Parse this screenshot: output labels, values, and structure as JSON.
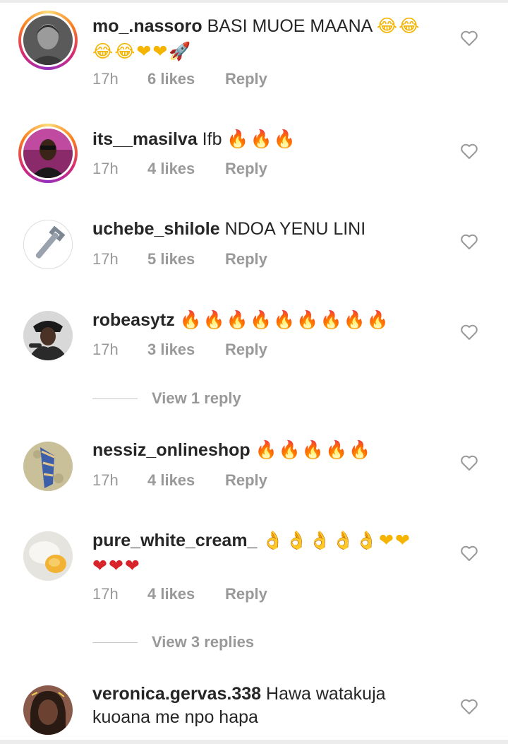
{
  "comments": [
    {
      "username": "mo_.nassoro",
      "text": "BASI MUOE MAANA",
      "emoji_line1": "😂😂",
      "emoji_line2": "😂😂❤❤🚀",
      "time": "17h",
      "likes": "6 likes",
      "reply": "Reply",
      "story_ring": true
    },
    {
      "username": "its__masilva",
      "text": "Ifb",
      "emoji": "🔥🔥🔥",
      "time": "17h",
      "likes": "4 likes",
      "reply": "Reply",
      "story_ring": true
    },
    {
      "username": "uchebe_shilole",
      "text": "NDOA YENU LINI",
      "time": "17h",
      "likes": "5 likes",
      "reply": "Reply",
      "story_ring": false
    },
    {
      "username": "robeasytz",
      "emoji": "🔥🔥🔥🔥🔥🔥🔥🔥🔥",
      "time": "17h",
      "likes": "3 likes",
      "reply": "Reply",
      "story_ring": false,
      "view_replies": "View 1 reply"
    },
    {
      "username": "nessiz_onlineshop",
      "emoji": "🔥🔥🔥🔥🔥",
      "time": "17h",
      "likes": "4 likes",
      "reply": "Reply",
      "story_ring": false
    },
    {
      "username": "pure_white_cream_",
      "emoji_line1": "👌👌👌👌👌❤❤",
      "emoji_line2": "❤❤❤",
      "time": "17h",
      "likes": "4 likes",
      "reply": "Reply",
      "story_ring": false,
      "view_replies": "View 3 replies"
    },
    {
      "username": "veronica.gervas.338",
      "text_line1": "Hawa watakuja",
      "text_line2": "kuoana me npo hapa",
      "story_ring": false
    }
  ],
  "colors": {
    "text": "#262626",
    "meta": "#999999",
    "fire": "#f58220",
    "heart": "#d8232a"
  }
}
